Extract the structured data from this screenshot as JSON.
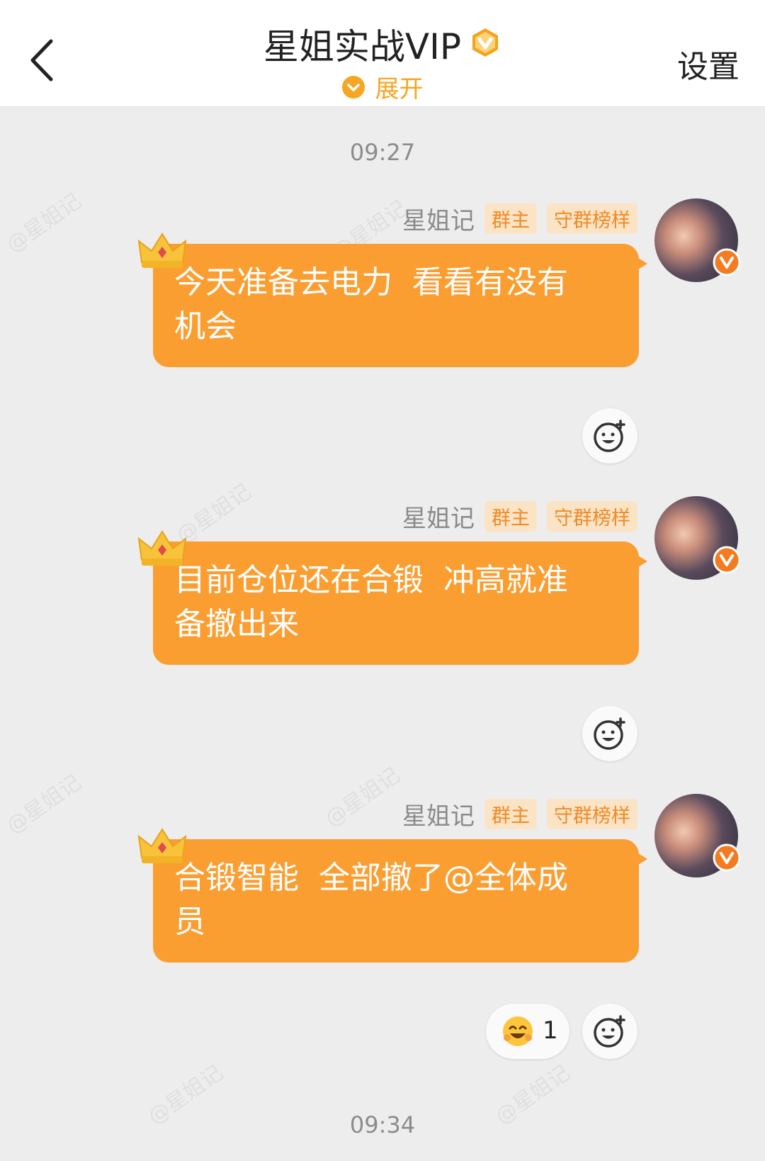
{
  "header": {
    "title": "星姐实战VIP",
    "expand_label": "展开",
    "settings_label": "设置"
  },
  "timestamps": [
    "09:27",
    "09:34"
  ],
  "messages": [
    {
      "sender": "星姐记",
      "tags": [
        "群主",
        "守群榜样"
      ],
      "text": "今天准备去电力  看看有没有\n机会"
    },
    {
      "sender": "星姐记",
      "tags": [
        "群主",
        "守群榜样"
      ],
      "text": "目前仓位还在合锻  冲高就准\n备撤出来"
    },
    {
      "sender": "星姐记",
      "tags": [
        "群主",
        "守群榜样"
      ],
      "text": "合锻智能  全部撤了@全体成\n员",
      "reaction_count": "1"
    }
  ],
  "watermark": "@星姐记",
  "colors": {
    "bubble": "#fb9e32",
    "tag_text": "#f08a24",
    "tag_bg": "#fbe3c6",
    "accent": "#f5a623",
    "background": "#ededed"
  },
  "icons": {
    "back": "chevron-left-icon",
    "vip": "vip-v-badge-icon",
    "expand": "chevron-down-circle-icon",
    "crown": "crown-icon",
    "react": "add-reaction-icon",
    "reaction": "laughing-emoji-icon"
  }
}
